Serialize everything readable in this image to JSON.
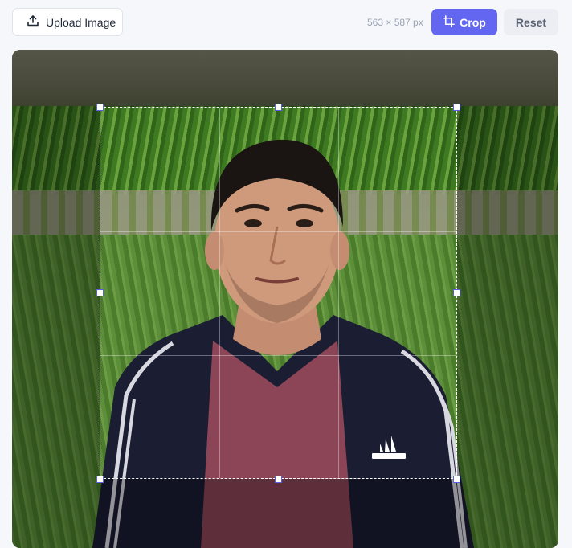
{
  "toolbar": {
    "upload_label": "Upload Image",
    "dimensions": "563 × 587 px",
    "crop_label": "Crop",
    "reset_label": "Reset"
  },
  "icons": {
    "upload": "upload-icon",
    "crop": "crop-icon"
  },
  "colors": {
    "accent": "#6366f1",
    "handle_border": "#5b5fe0",
    "reset_bg": "#eceef4"
  }
}
